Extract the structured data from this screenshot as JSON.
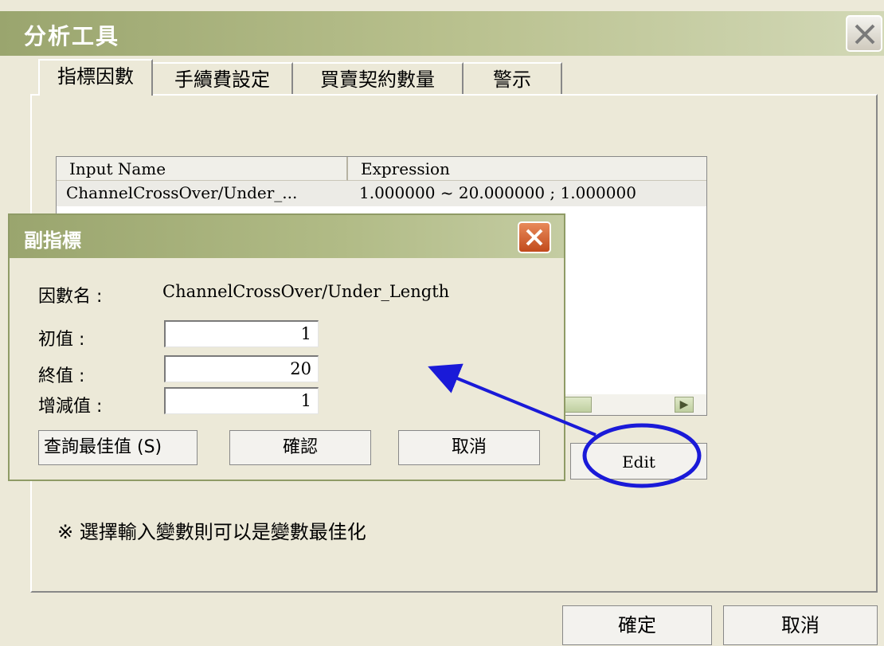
{
  "window": {
    "title": "分析工具"
  },
  "tabs": [
    {
      "label": "指標因數"
    },
    {
      "label": "手續費設定"
    },
    {
      "label": "買賣契約數量"
    },
    {
      "label": "警示"
    }
  ],
  "inputs_table": {
    "headers": [
      "Input Name",
      "Expression"
    ],
    "rows": [
      {
        "name": "ChannelCrossOver/Under_...",
        "expression": "1.000000 ~ 20.000000 ; 1.000000"
      }
    ]
  },
  "edit_button": "Edit",
  "note": "※ 選擇輸入變數則可以是變數最佳化",
  "footer": {
    "ok": "確定",
    "cancel": "取消"
  },
  "sub_dialog": {
    "title": "副指標",
    "factor_label": "因數名 :",
    "factor_value": "ChannelCrossOver/Under_Length",
    "initial_label": "初值 :",
    "initial_value": "1",
    "end_label": "終值 :",
    "end_value": "20",
    "step_label": "增減值 :",
    "step_value": "1",
    "query_best": "查詢最佳值 (S)",
    "confirm": "確認",
    "cancel": "取消"
  },
  "annotation": {
    "color": "#1a1ad8"
  }
}
